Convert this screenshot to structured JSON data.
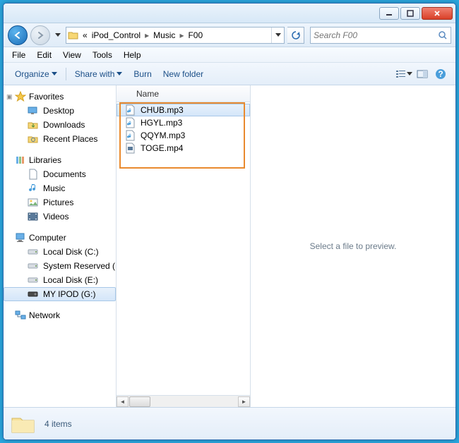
{
  "breadcrumb": {
    "prefix": "«",
    "items": [
      "iPod_Control",
      "Music",
      "F00"
    ]
  },
  "search": {
    "placeholder": "Search F00"
  },
  "menubar": [
    "File",
    "Edit",
    "View",
    "Tools",
    "Help"
  ],
  "toolbar": {
    "organize": "Organize",
    "share": "Share with",
    "burn": "Burn",
    "newfolder": "New folder"
  },
  "column": {
    "name": "Name"
  },
  "files": [
    {
      "name": "CHUB.mp3",
      "type": "audio",
      "selected": true
    },
    {
      "name": "HGYL.mp3",
      "type": "audio",
      "selected": false
    },
    {
      "name": "QQYM.mp3",
      "type": "audio",
      "selected": false
    },
    {
      "name": "TOGE.mp4",
      "type": "video",
      "selected": false
    }
  ],
  "nav": {
    "favorites": {
      "label": "Favorites",
      "items": [
        "Desktop",
        "Downloads",
        "Recent Places"
      ]
    },
    "libraries": {
      "label": "Libraries",
      "items": [
        "Documents",
        "Music",
        "Pictures",
        "Videos"
      ]
    },
    "computer": {
      "label": "Computer",
      "items": [
        "Local Disk (C:)",
        "System Reserved (D:)",
        "Local Disk (E:)",
        "MY IPOD (G:)"
      ],
      "selected": 3
    },
    "network": {
      "label": "Network"
    }
  },
  "preview": {
    "empty": "Select a file to preview."
  },
  "status": {
    "count": "4 items"
  }
}
